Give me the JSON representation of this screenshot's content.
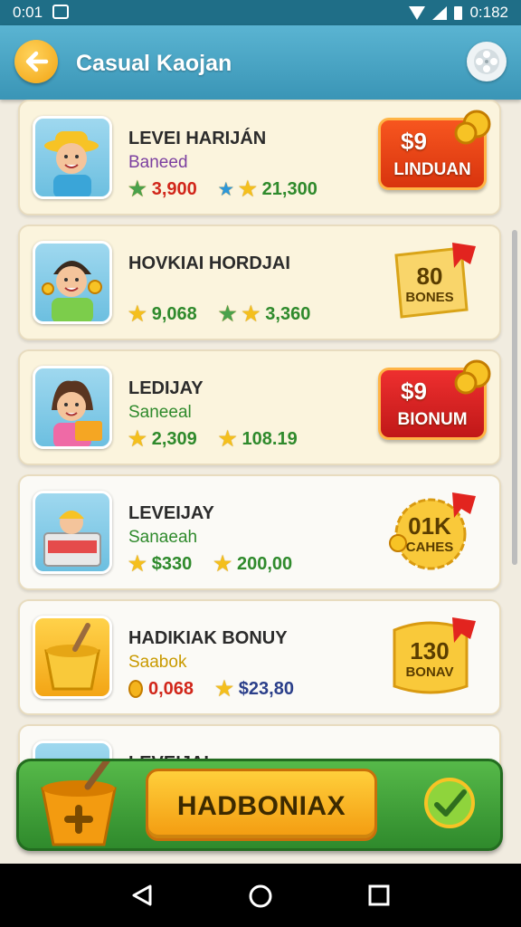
{
  "status_bar": {
    "time": "0:01",
    "right_time": "0:182"
  },
  "app_bar": {
    "title": "Casual Kaojan"
  },
  "cards": [
    {
      "title": "LEVEI HARIJÁN",
      "subtitle": "Baneed",
      "subtitle_color": "#7b3fa0",
      "stat1": "3,900",
      "stat1_color": "#d1261a",
      "stat2": "21,300",
      "stat2_color": "#2f8a2c",
      "reward": {
        "kind": "button",
        "amount": "$9",
        "label": "LINDUAN"
      }
    },
    {
      "title": "HOVKIAI HORDJAI",
      "subtitle": "",
      "stat1": "9,068",
      "stat1_color": "#2f8a2c",
      "stat2": "3,360",
      "stat2_color": "#2f8a2c",
      "reward": {
        "kind": "badge",
        "amount": "80",
        "label": "BONES"
      }
    },
    {
      "title": "LEDIJAY",
      "subtitle": "Saneeal",
      "subtitle_color": "#2f8a2c",
      "stat1": "2,309",
      "stat1_color": "#2f8a2c",
      "stat2": "108.19",
      "stat2_color": "#2f8a2c",
      "reward": {
        "kind": "button",
        "amount": "$9",
        "label": "BIONUM"
      }
    },
    {
      "title": "LEVEIJAY",
      "subtitle": "Sanaeah",
      "subtitle_color": "#2f8a2c",
      "stat1": "$330",
      "stat1_color": "#2f8a2c",
      "stat2": "200,00",
      "stat2_color": "#2f8a2c",
      "reward": {
        "kind": "badge",
        "amount": "01K",
        "label": "CAHES"
      }
    },
    {
      "title": "HADIKIAK BONUY",
      "subtitle": "Saabok",
      "subtitle_color": "#c99a00",
      "stat1": "0,068",
      "stat1_color": "#d1261a",
      "stat2": "$23,80",
      "stat2_color": "#2b3f8a",
      "reward": {
        "kind": "badge",
        "amount": "130",
        "label": "BONAV"
      }
    },
    {
      "title": "LEVEIJAI",
      "subtitle": "",
      "stat1": "",
      "stat2": "",
      "reward": {
        "kind": "badge",
        "amount": "",
        "label": ""
      }
    }
  ],
  "action_bar": {
    "main_label": "HADBONIAX"
  },
  "colors": {
    "accent": "#3a95b6",
    "action_green": "#2f8a2c",
    "button_orange": "#f39b10"
  }
}
